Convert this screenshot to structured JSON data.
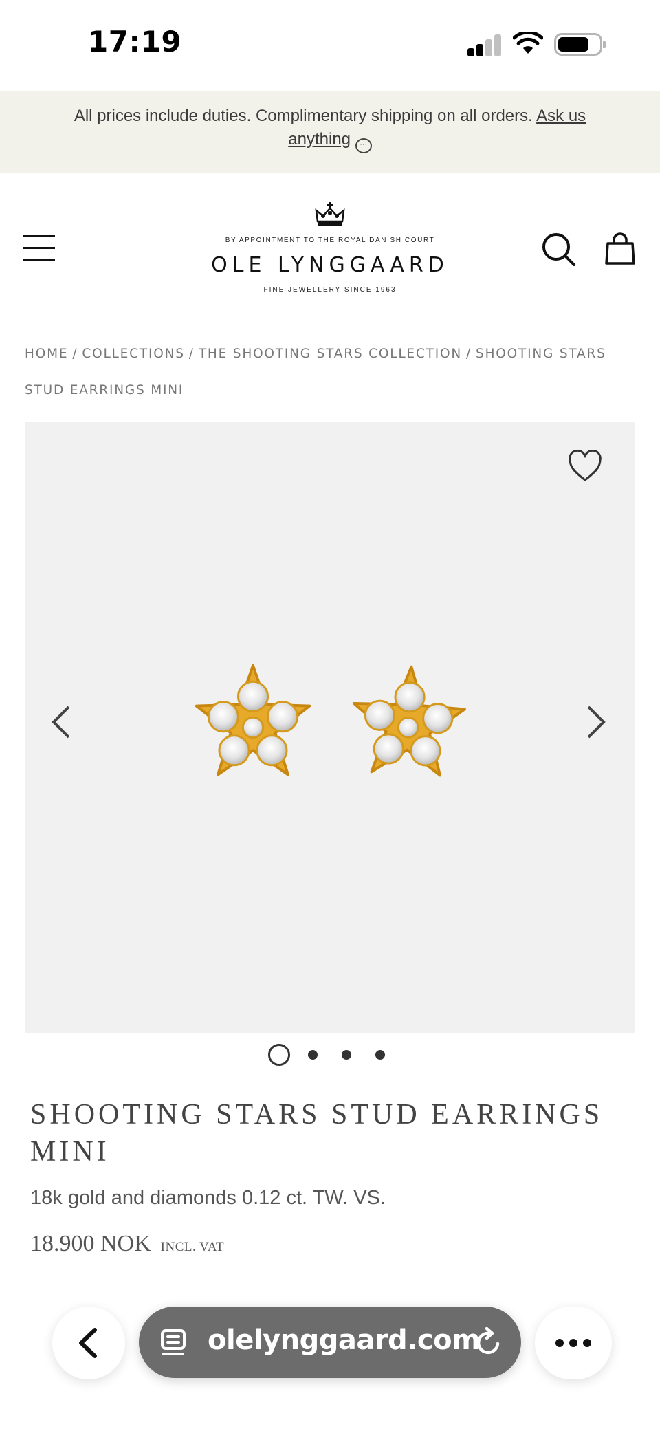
{
  "status_bar": {
    "time": "17:19"
  },
  "announcement": {
    "text": "All prices include duties. Complimentary shipping on all orders.",
    "link_part1": "Ask us",
    "link_part2": "anything",
    "chat_glyph": "···"
  },
  "header": {
    "logo_top": "BY APPOINTMENT TO THE ROYAL DANISH COURT",
    "logo_main": "OLE LYNGGAARD",
    "logo_sub": "FINE JEWELLERY SINCE 1963",
    "icons": [
      "menu-icon",
      "crown-icon",
      "search-icon",
      "bag-icon"
    ]
  },
  "breadcrumb": {
    "items": [
      "HOME",
      "COLLECTIONS",
      "THE SHOOTING STARS COLLECTION",
      "SHOOTING STARS STUD EARRINGS MINI"
    ],
    "separator": "/"
  },
  "gallery": {
    "image_count": 4,
    "active_index": 0,
    "icons": [
      "heart-icon",
      "chevron-left-icon",
      "chevron-right-icon"
    ],
    "colors": {
      "background": "#f1f1f1",
      "gold": "#e7a92a"
    }
  },
  "product": {
    "title": "SHOOTING STARS STUD EARRINGS MINI",
    "description": "18k gold and diamonds 0.12 ct. TW. VS.",
    "price": "18.900 NOK",
    "vat": "INCL. VAT"
  },
  "browser": {
    "url": "olelynggaard.com",
    "icons": [
      "back-chevron-icon",
      "page-icon",
      "reload-icon",
      "more-icon"
    ]
  }
}
